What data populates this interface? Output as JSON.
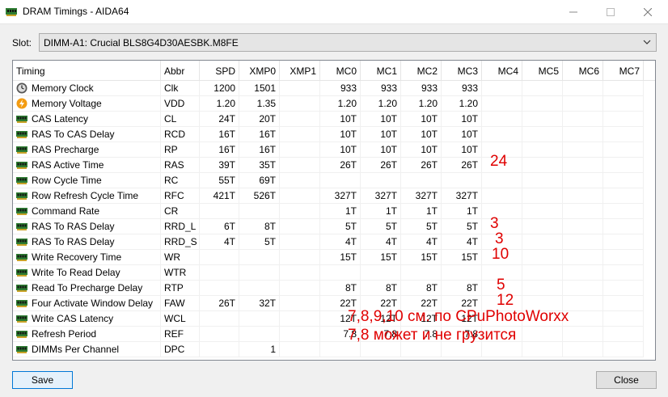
{
  "window": {
    "title": "DRAM Timings - AIDA64"
  },
  "slot": {
    "label": "Slot:",
    "value": "DIMM-A1: Crucial BLS8G4D30AESBK.M8FE"
  },
  "columns": [
    "Timing",
    "Abbr",
    "SPD",
    "XMP0",
    "XMP1",
    "MC0",
    "MC1",
    "MC2",
    "MC3",
    "MC4",
    "MC5",
    "MC6",
    "MC7"
  ],
  "rows": [
    {
      "icon": "clock-icon",
      "name": "Memory Clock",
      "abbr": "Clk",
      "spd": "1200",
      "xmp0": "1501",
      "xmp1": "",
      "mc": [
        "933",
        "933",
        "933",
        "933",
        "",
        "",
        "",
        ""
      ]
    },
    {
      "icon": "voltage-icon",
      "name": "Memory Voltage",
      "abbr": "VDD",
      "spd": "1.20",
      "xmp0": "1.35",
      "xmp1": "",
      "mc": [
        "1.20",
        "1.20",
        "1.20",
        "1.20",
        "",
        "",
        "",
        ""
      ]
    },
    {
      "icon": "ram-module-icon",
      "name": "CAS Latency",
      "abbr": "CL",
      "spd": "24T",
      "xmp0": "20T",
      "xmp1": "",
      "mc": [
        "10T",
        "10T",
        "10T",
        "10T",
        "",
        "",
        "",
        ""
      ]
    },
    {
      "icon": "ram-module-icon",
      "name": "RAS To CAS Delay",
      "abbr": "RCD",
      "spd": "16T",
      "xmp0": "16T",
      "xmp1": "",
      "mc": [
        "10T",
        "10T",
        "10T",
        "10T",
        "",
        "",
        "",
        ""
      ]
    },
    {
      "icon": "ram-module-icon",
      "name": "RAS Precharge",
      "abbr": "RP",
      "spd": "16T",
      "xmp0": "16T",
      "xmp1": "",
      "mc": [
        "10T",
        "10T",
        "10T",
        "10T",
        "",
        "",
        "",
        ""
      ]
    },
    {
      "icon": "ram-module-icon",
      "name": "RAS Active Time",
      "abbr": "RAS",
      "spd": "39T",
      "xmp0": "35T",
      "xmp1": "",
      "mc": [
        "26T",
        "26T",
        "26T",
        "26T",
        "",
        "",
        "",
        ""
      ]
    },
    {
      "icon": "ram-module-icon",
      "name": "Row Cycle Time",
      "abbr": "RC",
      "spd": "55T",
      "xmp0": "69T",
      "xmp1": "",
      "mc": [
        "",
        "",
        "",
        "",
        "",
        "",
        "",
        ""
      ]
    },
    {
      "icon": "ram-module-icon",
      "name": "Row Refresh Cycle Time",
      "abbr": "RFC",
      "spd": "421T",
      "xmp0": "526T",
      "xmp1": "",
      "mc": [
        "327T",
        "327T",
        "327T",
        "327T",
        "",
        "",
        "",
        ""
      ]
    },
    {
      "icon": "ram-module-icon",
      "name": "Command Rate",
      "abbr": "CR",
      "spd": "",
      "xmp0": "",
      "xmp1": "",
      "mc": [
        "1T",
        "1T",
        "1T",
        "1T",
        "",
        "",
        "",
        ""
      ]
    },
    {
      "icon": "ram-module-icon",
      "name": "RAS To RAS Delay",
      "abbr": "RRD_L",
      "spd": "6T",
      "xmp0": "8T",
      "xmp1": "",
      "mc": [
        "5T",
        "5T",
        "5T",
        "5T",
        "",
        "",
        "",
        ""
      ]
    },
    {
      "icon": "ram-module-icon",
      "name": "RAS To RAS Delay",
      "abbr": "RRD_S",
      "spd": "4T",
      "xmp0": "5T",
      "xmp1": "",
      "mc": [
        "4T",
        "4T",
        "4T",
        "4T",
        "",
        "",
        "",
        ""
      ]
    },
    {
      "icon": "ram-module-icon",
      "name": "Write Recovery Time",
      "abbr": "WR",
      "spd": "",
      "xmp0": "",
      "xmp1": "",
      "mc": [
        "15T",
        "15T",
        "15T",
        "15T",
        "",
        "",
        "",
        ""
      ]
    },
    {
      "icon": "ram-module-icon",
      "name": "Write To Read Delay",
      "abbr": "WTR",
      "spd": "",
      "xmp0": "",
      "xmp1": "",
      "mc": [
        "",
        "",
        "",
        "",
        "",
        "",
        "",
        ""
      ]
    },
    {
      "icon": "ram-module-icon",
      "name": "Read To Precharge Delay",
      "abbr": "RTP",
      "spd": "",
      "xmp0": "",
      "xmp1": "",
      "mc": [
        "8T",
        "8T",
        "8T",
        "8T",
        "",
        "",
        "",
        ""
      ]
    },
    {
      "icon": "ram-module-icon",
      "name": "Four Activate Window Delay",
      "abbr": "FAW",
      "spd": "26T",
      "xmp0": "32T",
      "xmp1": "",
      "mc": [
        "22T",
        "22T",
        "22T",
        "22T",
        "",
        "",
        "",
        ""
      ]
    },
    {
      "icon": "ram-module-icon",
      "name": "Write CAS Latency",
      "abbr": "WCL",
      "spd": "",
      "xmp0": "",
      "xmp1": "",
      "mc": [
        "12T",
        "12T",
        "12T",
        "12T",
        "",
        "",
        "",
        ""
      ]
    },
    {
      "icon": "ram-module-icon",
      "name": "Refresh Period",
      "abbr": "REF",
      "spd": "",
      "xmp0": "",
      "xmp1": "",
      "mc": [
        "7.8",
        "7.8",
        "7.8",
        "7.8",
        "",
        "",
        "",
        ""
      ]
    },
    {
      "icon": "ram-module-icon",
      "name": "DIMMs Per Channel",
      "abbr": "DPC",
      "spd": "",
      "xmp0": "1",
      "xmp1": "",
      "mc": [
        "",
        "",
        "",
        "",
        "",
        "",
        "",
        ""
      ]
    }
  ],
  "annotations": {
    "a24": "24",
    "a3a": "3",
    "a3b": "3",
    "a10": "10",
    "a5": "5",
    "a12": "12",
    "line1": "7,8,9,10 см. по CPuPhotoWorxx",
    "line2": "7,8 может и не грузится"
  },
  "buttons": {
    "save": "Save",
    "close": "Close"
  },
  "colors": {
    "annotation": "#e00000",
    "accent": "#0078d7"
  }
}
